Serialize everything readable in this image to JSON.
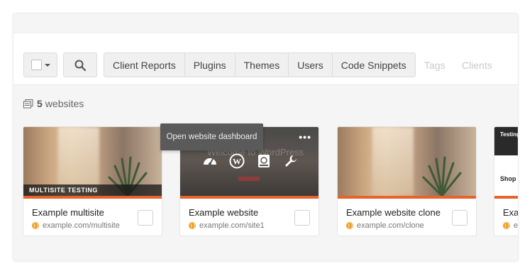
{
  "toolbar": {
    "filters": [
      "Client Reports",
      "Plugins",
      "Themes",
      "Users",
      "Code Snippets"
    ],
    "muted_filters": [
      "Tags",
      "Clients"
    ]
  },
  "summary": {
    "count": "5",
    "label": "websites"
  },
  "tooltip": "Open website dashboard",
  "cards": [
    {
      "name": "Example multisite",
      "url": "example.com/multisite",
      "caption": "MULTISITE TESTING"
    },
    {
      "name": "Example website",
      "url": "example.com/site1",
      "thumb_text": "Welcome to WordPress"
    },
    {
      "name": "Example website clone",
      "url": "example.com/clone"
    },
    {
      "name": "Exa",
      "url": "exa",
      "thumb_text": "Testing shop for migratio",
      "thumb_shop": "Shop"
    }
  ],
  "colors": {
    "accent": "#e8622b",
    "globe": "#f0a12b"
  }
}
